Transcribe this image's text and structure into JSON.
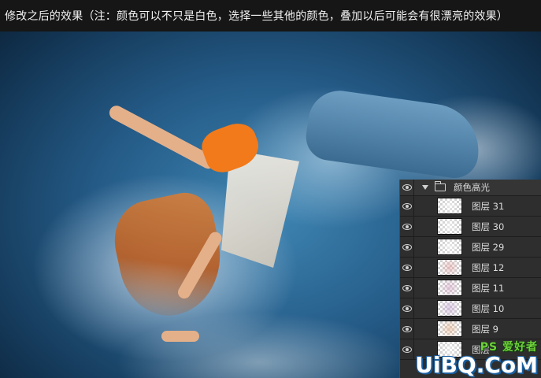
{
  "caption": {
    "text": "修改之后的效果（注：颜色可以不只是白色，选择一些其他的颜色，叠加以后可能会有很漂亮的效果）"
  },
  "layers_panel": {
    "group": {
      "name": "颜色高光",
      "icon": "folder-icon",
      "expanded": true
    },
    "layers": [
      {
        "name": "图层 31",
        "thumb_tint": "#ffffff"
      },
      {
        "name": "图层 30",
        "thumb_tint": "#ffffff"
      },
      {
        "name": "图层 29",
        "thumb_tint": "#ffffff"
      },
      {
        "name": "图层 12",
        "thumb_tint": "#e6a3a3"
      },
      {
        "name": "图层 11",
        "thumb_tint": "#d7a9c8"
      },
      {
        "name": "图层 10",
        "thumb_tint": "#c6a7d6"
      },
      {
        "name": "图层 9",
        "thumb_tint": "#e9b38b"
      },
      {
        "name": "图层",
        "thumb_tint": "#ffffff"
      }
    ]
  },
  "watermark": {
    "top": "PS 爱好者",
    "main": "UiBQ.CoM"
  },
  "colors": {
    "panel_bg": "#2e2e2e",
    "caption_bg": "#161616",
    "watermark_green": "#6fd13a",
    "watermark_blue": "#1a5fa0"
  }
}
